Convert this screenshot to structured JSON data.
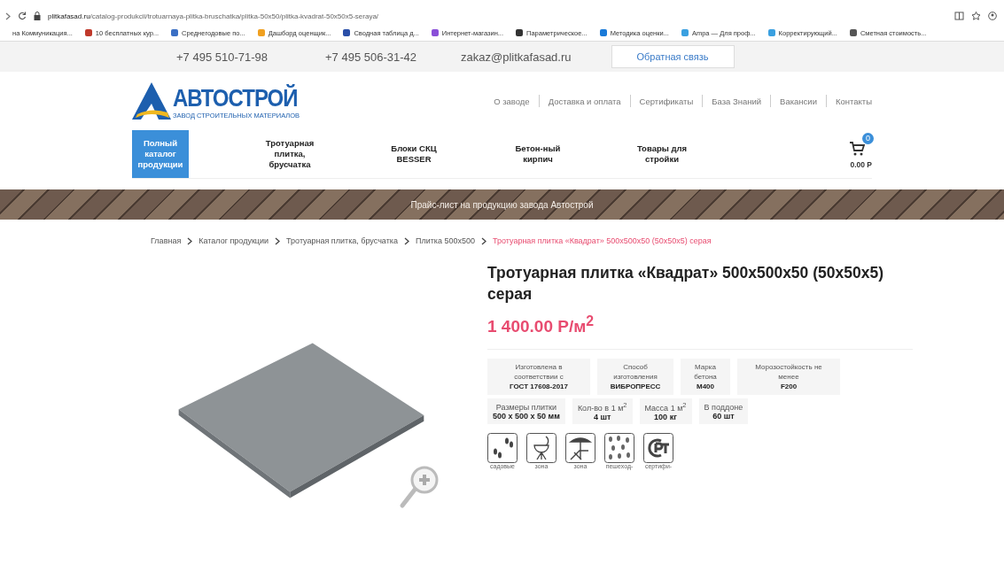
{
  "browser": {
    "url_host": "plitkafasad.ru",
    "url_path": "/catalog-produkcii/trotuarnaya-plitka-bruschatka/plitka-50x50/plitka-kvadrat-50x50x5-seraya/",
    "bookmarks": [
      {
        "label": "на Коммуникация...",
        "color": "#ffffff"
      },
      {
        "label": "10 бесплатных кур...",
        "color": "#c0392b"
      },
      {
        "label": "Среднегодовые по...",
        "color": "#3a6fc4"
      },
      {
        "label": "Дашборд оценщик...",
        "color": "#f0a020"
      },
      {
        "label": "Сводная таблица д...",
        "color": "#2a4fa8"
      },
      {
        "label": "Интернет-магазин...",
        "color": "#8a4fd8"
      },
      {
        "label": "Параметрическое...",
        "color": "#333333"
      },
      {
        "label": "Методика оценки...",
        "color": "#1a7ad8"
      },
      {
        "label": "Ampa — Для проф...",
        "color": "#3aa0e0"
      },
      {
        "label": "Корректирующий...",
        "color": "#3aa0e0"
      },
      {
        "label": "Сметная стоимость...",
        "color": "#555555"
      }
    ]
  },
  "topbar": {
    "phones": [
      "+7 495 510-71-98",
      "+7 495 506-31-42"
    ],
    "email": "zakaz@plitkafasad.ru",
    "feedback_button": "Обратная связь"
  },
  "logo": {
    "name": "АВТОСТРОЙ",
    "tagline": "ЗАВОД СТРОИТЕЛЬНЫХ МАТЕРИАЛОВ"
  },
  "top_menu": [
    "О заводе",
    "Доставка и оплата",
    "Сертификаты",
    "База Знаний",
    "Вакансии",
    "Контакты"
  ],
  "nav": [
    {
      "label": "Полный каталог продукции",
      "selected": true
    },
    {
      "label": "Тротуарная плитка, брусчатка",
      "selected": false
    },
    {
      "label": "Блоки СКЦ BESSER",
      "selected": false
    },
    {
      "label": "Бетон-ный кирпич",
      "selected": false
    },
    {
      "label": "Товары для стройки",
      "selected": false
    }
  ],
  "cart": {
    "count": "0",
    "total": "0.00 Р"
  },
  "banner": "Прайс-лист на продукцию завода Автострой",
  "breadcrumbs": [
    {
      "label": "Главная",
      "current": false
    },
    {
      "label": "Каталог продукции",
      "current": false
    },
    {
      "label": "Тротуарная плитка, брусчатка",
      "current": false
    },
    {
      "label": "Плитка 500х500",
      "current": false
    },
    {
      "label": "Тротуарная плитка «Квадрат» 500х500х50 (50х50х5) серая",
      "current": true
    }
  ],
  "product": {
    "title": "Тротуарная плитка «Квадрат» 500х500х50 (50х50х5) серая",
    "price": "1 400.00 Р/м$^{2}$",
    "specs": [
      [
        {
          "label": "Изготовлена в соответствии с",
          "value": "ГОСТ 17608-2017"
        },
        {
          "label": "Способ изготовления",
          "value": "ВИБРОПРЕСС"
        },
        {
          "label": "Марка бетона",
          "value": "М400"
        },
        {
          "label": "Морозостойкость не менее",
          "value": "F200"
        }
      ],
      [
        {
          "label": "Размеры плитки",
          "value": "500 x 500 x 50 мм"
        },
        {
          "label": "Кол-во в 1 м$^{2}$",
          "value": "4 шт"
        },
        {
          "label": "Масса 1 м$^{2}$",
          "value": "100 кг"
        },
        {
          "label": "В поддоне",
          "value": "60 шт"
        }
      ]
    ],
    "features": [
      {
        "kind": "footprints",
        "label": "садовые"
      },
      {
        "kind": "grill",
        "label": "зона"
      },
      {
        "kind": "deckchair",
        "label": "зона"
      },
      {
        "kind": "crowd",
        "label": "пешеход-"
      },
      {
        "kind": "cert",
        "label": "сертифи-"
      }
    ]
  }
}
